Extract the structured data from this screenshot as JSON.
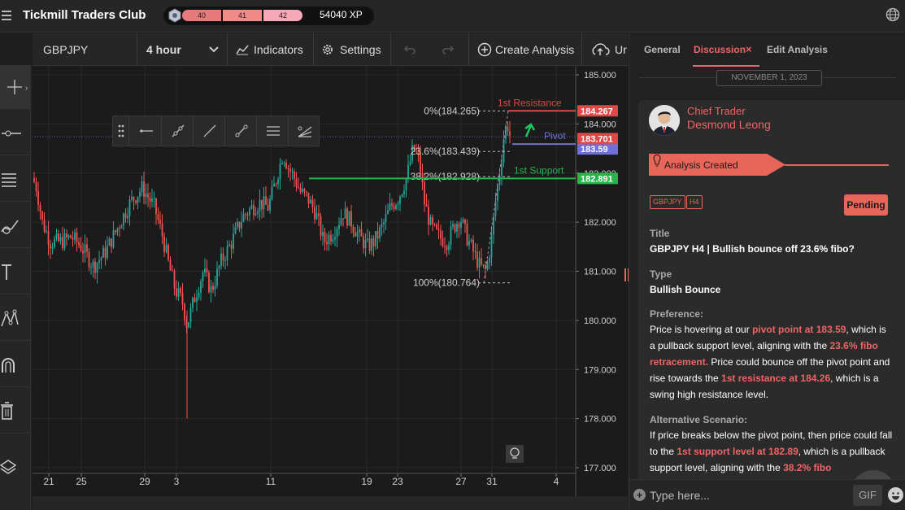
{
  "app": {
    "title": "Tickmill Traders Club",
    "levels": [
      "40",
      "41",
      "42"
    ],
    "xp": "54040 XP",
    "level_progress": 0.62
  },
  "toolbar": {
    "symbol": "GBPJPY",
    "timeframe": "4 hour",
    "indicators_label": "Indicators",
    "settings_label": "Settings",
    "create_analysis_label": "Create Analysis",
    "upload_label": "Ur"
  },
  "chart": {
    "price_labels": [
      "185.000",
      "184.000",
      "183.000",
      "182.000",
      "181.000",
      "180.000",
      "179.000",
      "178.000",
      "177.000"
    ],
    "date_labels": [
      "21",
      "25",
      "29",
      "3",
      "11",
      "19",
      "23",
      "27",
      "31",
      "4"
    ],
    "fib_levels": [
      {
        "label": "0%(184.265)",
        "price": 184.265
      },
      {
        "label": "23.6%(183.439)",
        "price": 183.439
      },
      {
        "label": "38.2%(182.928)",
        "price": 182.928
      },
      {
        "label": "100%(180.764)",
        "price": 180.764
      }
    ],
    "lines": {
      "resistance": {
        "label": "1st Resistance",
        "price": 184.267,
        "tag": "184.267",
        "color": "#e04848"
      },
      "pivot": {
        "label": "Pivot",
        "price": 183.59,
        "tag": "183.59",
        "color": "#7070d8"
      },
      "support": {
        "label": "1st Support",
        "price": 182.891,
        "tag": "182.891",
        "color": "#2bb24c"
      },
      "last_price": {
        "price": 183.701,
        "tag": "183.701",
        "color": "#e04848"
      }
    },
    "colors": {
      "up": "#26a69a",
      "down": "#ef5350"
    }
  },
  "panel": {
    "tabs": [
      "General",
      "Discussion",
      "Edit Analysis"
    ],
    "active_tab": "Discussion",
    "date": "NOVEMBER 1, 2023",
    "role": "Chief Trader",
    "author": "Desmond Leong",
    "banner": "Analysis Created",
    "tags": [
      "GBPJPY",
      "H4"
    ],
    "status": "Pending",
    "title_label": "Title",
    "title_value": "GBPJPY H4 | Bullish bounce off 23.6% fibo?",
    "type_label": "Type",
    "type_value": "Bullish Bounce",
    "preference_label": "Preference:",
    "preference": {
      "t1": "Price is hovering at our ",
      "h1": "pivot point at 183.59",
      "t2": ", which is a pullback support level, aligning with the ",
      "h2": "23.6% fibo retracement.",
      "t3": " Price could bounce off the pivot point and rise towards the ",
      "h3": "1st resistance at 184.26",
      "t4": ", which is a swing high resistance level."
    },
    "alt_label": "Alternative Scenario:",
    "alt": {
      "t1": "If price breaks below the pivot point, then price could fall to the ",
      "h1": "1st support level at 182.89",
      "t2": ", which is a pullback support level, aligning with the ",
      "h2": "38.2% fibo"
    },
    "input_placeholder": "Type here...",
    "gif_label": "GIF"
  }
}
